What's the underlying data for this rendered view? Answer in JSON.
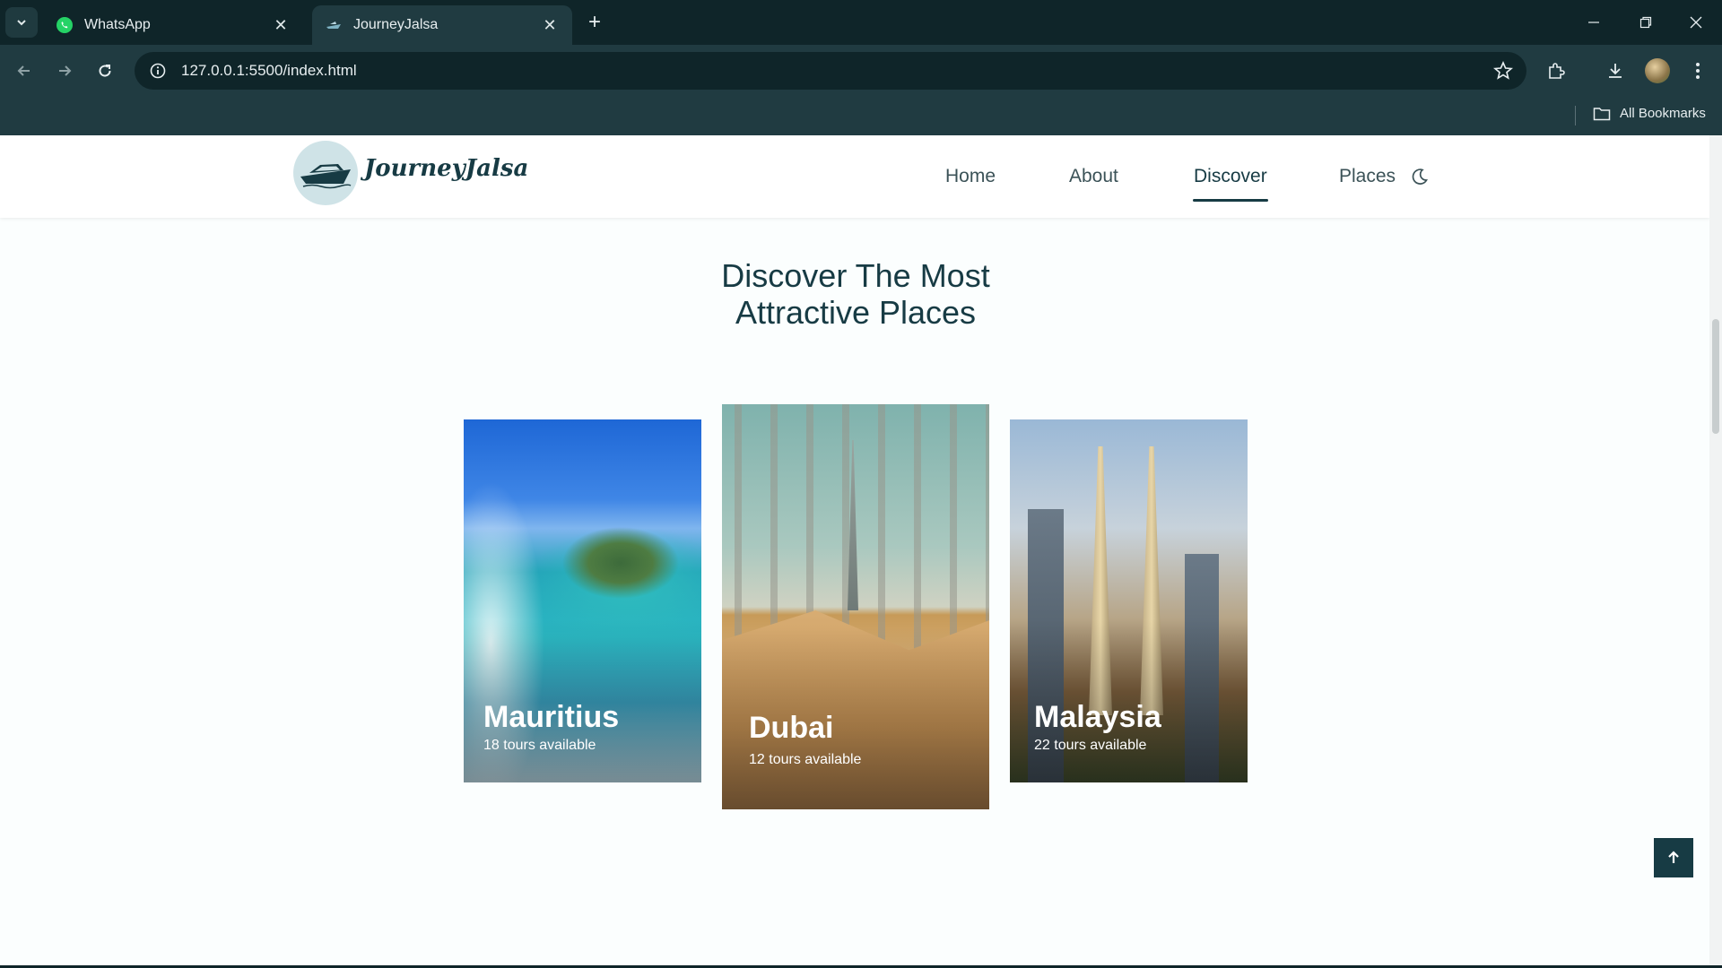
{
  "browser": {
    "tabs": [
      {
        "title": "WhatsApp",
        "active": false,
        "icon": "whatsapp-icon"
      },
      {
        "title": "JourneyJalsa",
        "active": true,
        "icon": "boat-icon"
      }
    ],
    "url": "127.0.0.1:5500/index.html",
    "bookmarks_label": "All Bookmarks"
  },
  "site": {
    "logo_text": "JourneyJalsa",
    "nav": [
      {
        "label": "Home",
        "active": false
      },
      {
        "label": "About",
        "active": false
      },
      {
        "label": "Discover",
        "active": true
      },
      {
        "label": "Places",
        "active": false
      }
    ],
    "theme_toggle_icon": "moon-icon"
  },
  "section": {
    "title_line1": "Discover The Most",
    "title_line2": "Attractive Places"
  },
  "places": [
    {
      "name": "Mauritius",
      "tours": "18 tours available"
    },
    {
      "name": "Dubai",
      "tours": "12 tours available"
    },
    {
      "name": "Malaysia",
      "tours": "22 tours available"
    }
  ],
  "colors": {
    "primary": "#173b44",
    "page_bg": "#fbfefe",
    "browser_dark": "#0f2529",
    "browser_toolbar": "#203b41"
  }
}
